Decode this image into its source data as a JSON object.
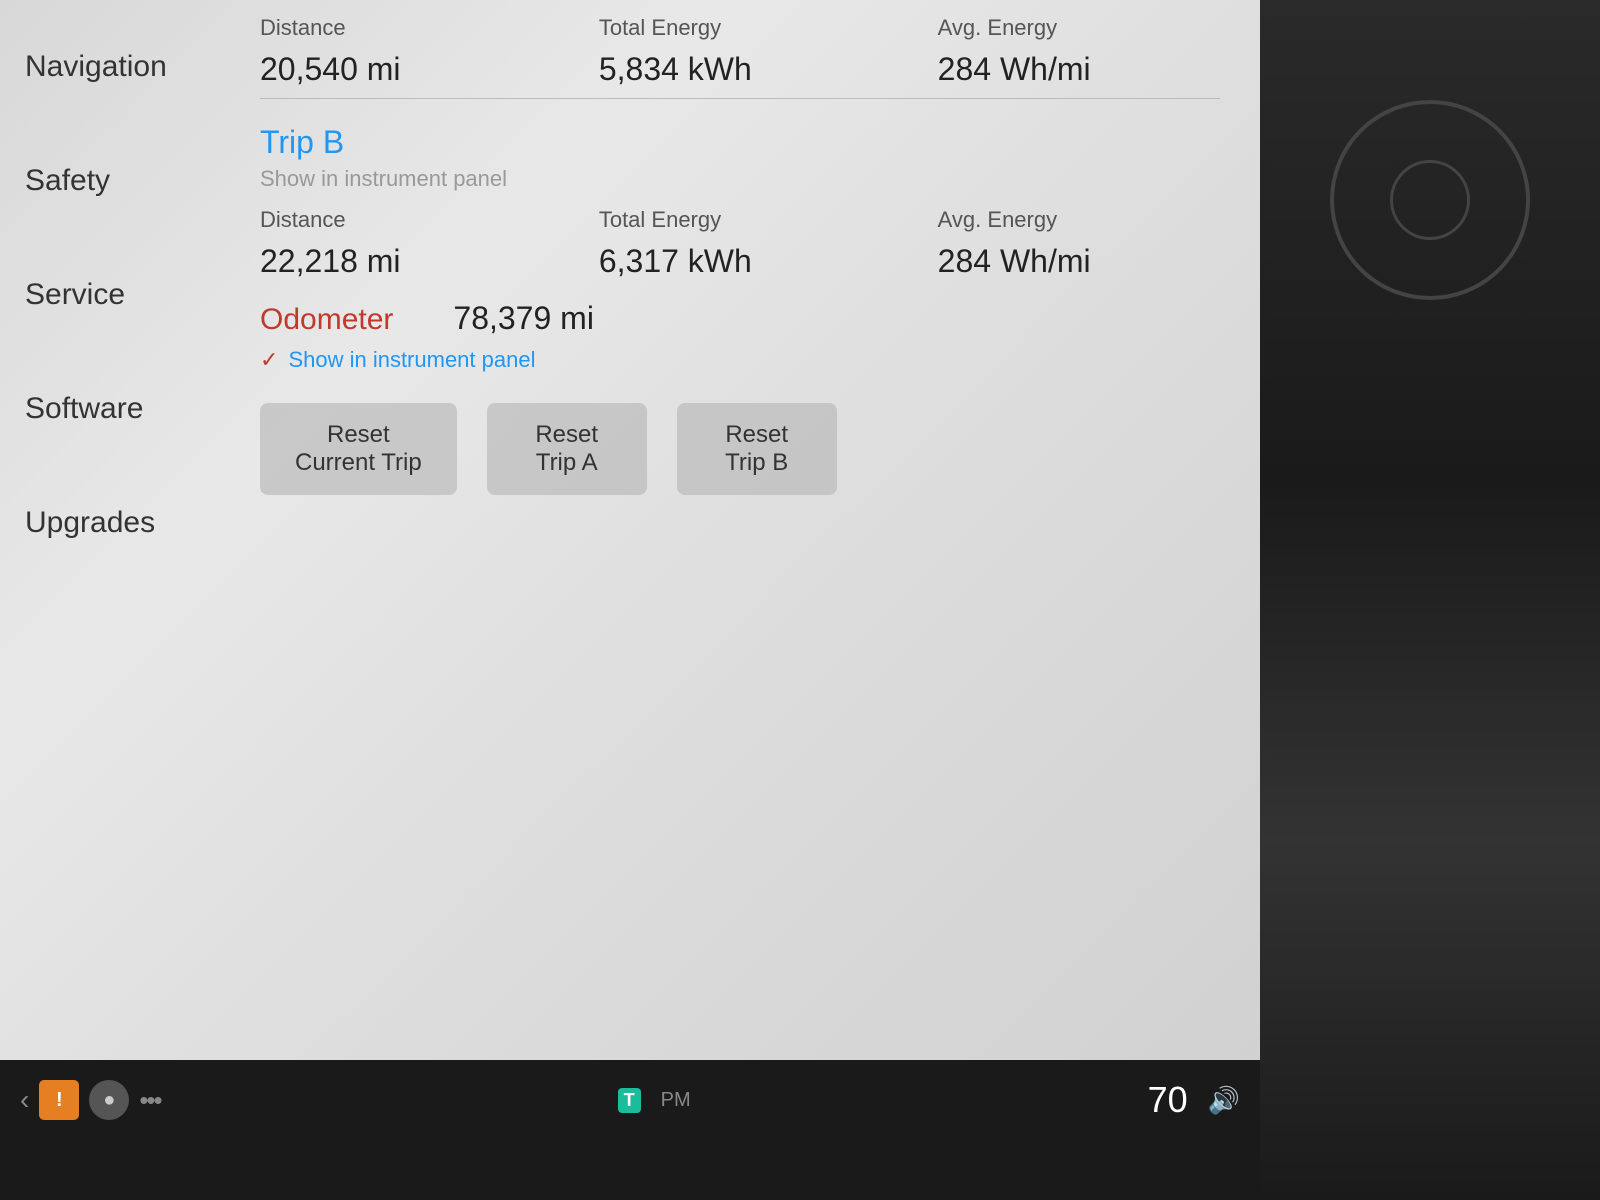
{
  "sidebar": {
    "items": [
      {
        "label": "Navigation",
        "active": false
      },
      {
        "label": "Safety",
        "active": false
      },
      {
        "label": "Service",
        "active": false
      },
      {
        "label": "Software",
        "active": false
      },
      {
        "label": "Upgrades",
        "active": false
      }
    ]
  },
  "tripA": {
    "distance_label": "Distance",
    "total_energy_label": "Total Energy",
    "avg_energy_label": "Avg. Energy",
    "distance_value": "20,540 mi",
    "total_energy_value": "5,834 kWh",
    "avg_energy_value": "284 Wh/mi"
  },
  "tripB": {
    "title": "Trip B",
    "show_instrument_label": "Show in instrument panel",
    "distance_label": "Distance",
    "total_energy_label": "Total Energy",
    "avg_energy_label": "Avg. Energy",
    "distance_value": "22,218 mi",
    "total_energy_value": "6,317 kWh",
    "avg_energy_value": "284 Wh/mi"
  },
  "odometer": {
    "label": "Odometer",
    "value": "78,379 mi",
    "show_instrument_label": "Show in instrument panel"
  },
  "buttons": {
    "reset_current_trip": "Reset\nCurrent Trip",
    "reset_trip_a": "Reset\nTrip A",
    "reset_trip_b": "Reset\nTrip B"
  },
  "taskbar": {
    "speed": "70",
    "nav_back": "‹",
    "dots": "•••"
  }
}
